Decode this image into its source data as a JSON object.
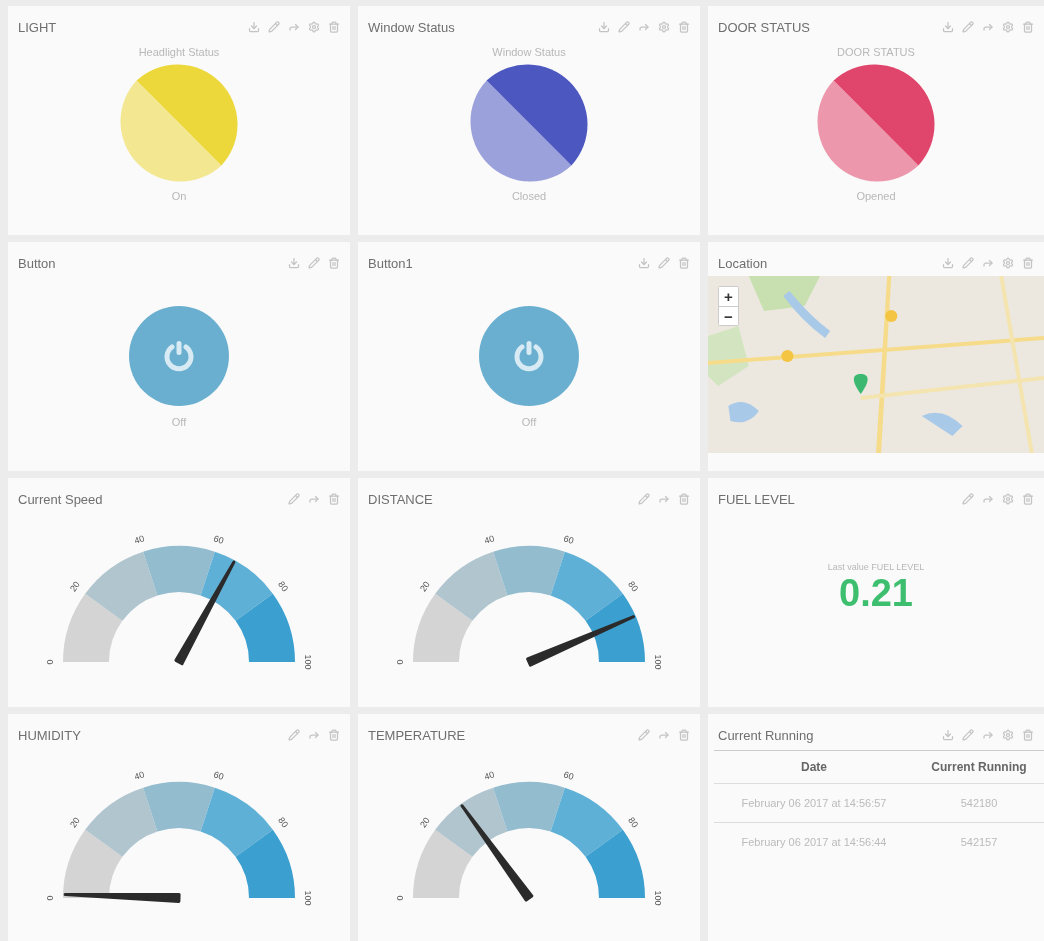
{
  "widgets": [
    {
      "kind": "status",
      "title": "LIGHT",
      "actions": [
        {
          "kind": "download"
        },
        {
          "kind": "edit"
        },
        {
          "kind": "share"
        },
        {
          "kind": "settings"
        },
        {
          "kind": "delete"
        }
      ],
      "caption": "Headlight Status",
      "color": "#ecd83a",
      "value": "On"
    },
    {
      "kind": "status",
      "title": "Window Status",
      "actions": [
        {
          "kind": "download"
        },
        {
          "kind": "edit"
        },
        {
          "kind": "share"
        },
        {
          "kind": "settings"
        },
        {
          "kind": "delete"
        }
      ],
      "caption": "Window Status",
      "color": "#4c57c0",
      "value": "Closed"
    },
    {
      "kind": "status",
      "title": "DOOR STATUS",
      "actions": [
        {
          "kind": "download"
        },
        {
          "kind": "edit"
        },
        {
          "kind": "share"
        },
        {
          "kind": "settings"
        },
        {
          "kind": "delete"
        }
      ],
      "caption": "DOOR STATUS",
      "color": "#e0466b",
      "value": "Opened"
    },
    {
      "kind": "button",
      "title": "Button",
      "actions": [
        {
          "kind": "download"
        },
        {
          "kind": "edit"
        },
        {
          "kind": "delete"
        }
      ],
      "on": false,
      "value": "Off"
    },
    {
      "kind": "button",
      "title": "Button1",
      "actions": [
        {
          "kind": "download"
        },
        {
          "kind": "edit"
        },
        {
          "kind": "delete"
        }
      ],
      "on": false,
      "value": "Off"
    },
    {
      "kind": "map",
      "title": "Location",
      "actions": [
        {
          "kind": "download"
        },
        {
          "kind": "edit"
        },
        {
          "kind": "share"
        },
        {
          "kind": "settings"
        },
        {
          "kind": "delete"
        }
      ],
      "zoom_in": "+",
      "zoom_out": "−"
    },
    {
      "kind": "gauge",
      "title": "Current Speed",
      "actions": [
        {
          "kind": "edit"
        },
        {
          "kind": "share"
        },
        {
          "kind": "delete"
        }
      ],
      "ticks": [
        "0",
        "20",
        "40",
        "60",
        "80",
        "100"
      ]
    },
    {
      "kind": "gauge",
      "title": "DISTANCE",
      "actions": [
        {
          "kind": "edit"
        },
        {
          "kind": "share"
        },
        {
          "kind": "delete"
        }
      ],
      "ticks": [
        "0",
        "20",
        "40",
        "60",
        "80",
        "100"
      ]
    },
    {
      "kind": "value",
      "title": "FUEL LEVEL",
      "actions": [
        {
          "kind": "edit"
        },
        {
          "kind": "share"
        },
        {
          "kind": "settings"
        },
        {
          "kind": "delete"
        }
      ],
      "caption": "Last value FUEL LEVEL",
      "value": "0.21"
    },
    {
      "kind": "gauge",
      "title": "HUMIDITY",
      "actions": [
        {
          "kind": "edit"
        },
        {
          "kind": "share"
        },
        {
          "kind": "delete"
        }
      ],
      "ticks": [
        "0",
        "20",
        "40",
        "60",
        "80",
        "100"
      ]
    },
    {
      "kind": "gauge",
      "title": "TEMPERATURE",
      "actions": [
        {
          "kind": "edit"
        },
        {
          "kind": "share"
        },
        {
          "kind": "delete"
        }
      ],
      "ticks": [
        "0",
        "20",
        "40",
        "60",
        "80",
        "100"
      ]
    },
    {
      "kind": "table",
      "title": "Current Running",
      "actions": [
        {
          "kind": "download"
        },
        {
          "kind": "edit"
        },
        {
          "kind": "share"
        },
        {
          "kind": "settings"
        },
        {
          "kind": "delete"
        }
      ],
      "columns": [
        "Date",
        "Current Running"
      ],
      "rows": [
        [
          "February 06 2017 at 14:56:57",
          "542180"
        ],
        [
          "February 06 2017 at 14:56:44",
          "542157"
        ]
      ]
    }
  ]
}
